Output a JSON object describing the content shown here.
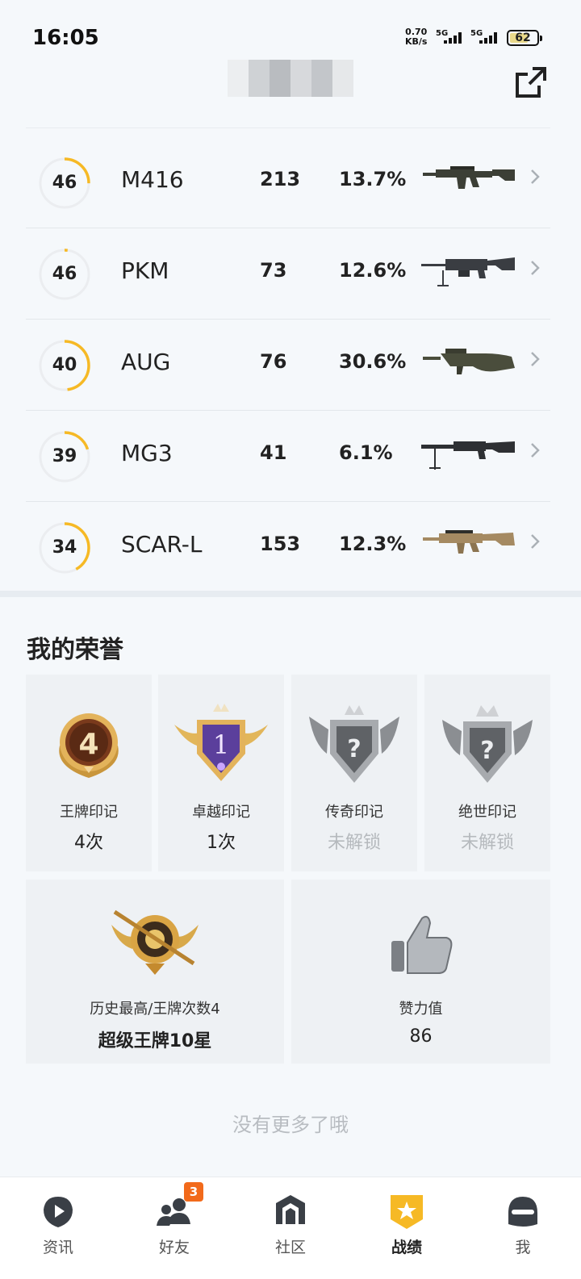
{
  "status_bar": {
    "time": "16:05",
    "net_speed": "0.70",
    "net_unit": "KB/s",
    "signal1": "5G",
    "signal2": "5G",
    "battery": "62"
  },
  "weapons": [
    {
      "level": "46",
      "name": "M416",
      "kills": "213",
      "rate": "13.7%",
      "progress": 0.25,
      "icon": "m416-icon",
      "color": "#3c3f36"
    },
    {
      "level": "46",
      "name": "PKM",
      "kills": "73",
      "rate": "12.6%",
      "progress": 0.02,
      "icon": "pkm-icon",
      "color": "#3a3d42"
    },
    {
      "level": "40",
      "name": "AUG",
      "kills": "76",
      "rate": "30.6%",
      "progress": 0.48,
      "icon": "aug-icon",
      "color": "#4a4d3c"
    },
    {
      "level": "39",
      "name": "MG3",
      "kills": "41",
      "rate": "6.1%",
      "progress": 0.2,
      "icon": "mg3-icon",
      "color": "#2e3033"
    },
    {
      "level": "34",
      "name": "SCAR-L",
      "kills": "153",
      "rate": "12.3%",
      "progress": 0.42,
      "icon": "scar-l-icon",
      "color": "#a58a62"
    }
  ],
  "honor": {
    "title": "我的荣誉",
    "marks": [
      {
        "label": "王牌印记",
        "value": "4次",
        "locked": false,
        "badge": "ace-mark-badge",
        "badge_text": "4"
      },
      {
        "label": "卓越印记",
        "value": "1次",
        "locked": false,
        "badge": "excellence-mark-badge",
        "badge_text": "1"
      },
      {
        "label": "传奇印记",
        "value": "未解锁",
        "locked": true,
        "badge": "legend-mark-badge",
        "badge_text": "?"
      },
      {
        "label": "绝世印记",
        "value": "未解锁",
        "locked": true,
        "badge": "peerless-mark-badge",
        "badge_text": "?"
      }
    ],
    "highest": {
      "label": "历史最高/王牌次数4",
      "value": "超级王牌10星"
    },
    "likes": {
      "label": "赞力值",
      "value": "86"
    }
  },
  "footer_text": "没有更多了哦",
  "tabs": [
    {
      "label": "资讯",
      "icon": "news-play-icon",
      "active": false
    },
    {
      "label": "好友",
      "icon": "friends-icon",
      "active": false,
      "badge": "3"
    },
    {
      "label": "社区",
      "icon": "community-icon",
      "active": false
    },
    {
      "label": "战绩",
      "icon": "record-trophy-icon",
      "active": true
    },
    {
      "label": "我",
      "icon": "helmet-profile-icon",
      "active": false
    }
  ],
  "colors": {
    "accent": "#f6b925",
    "badge": "#f26a1b"
  }
}
